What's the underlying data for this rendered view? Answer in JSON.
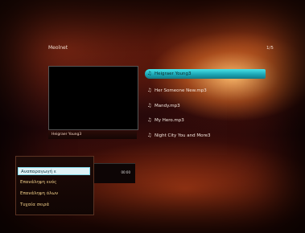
{
  "player": {
    "folder_title": "Meolnet",
    "track_counter": "1/5",
    "now_playing": "Heigraer Young3",
    "time_label": "00:00"
  },
  "tracks": [
    {
      "label": "Heigraer Young3",
      "icon": "music-note-icon"
    },
    {
      "label": "Her Someone New.mp3",
      "icon": "music-note-icon"
    },
    {
      "label": "Mandy.mp3",
      "icon": "music-note-icon"
    },
    {
      "label": "My Hero.mp3",
      "icon": "music-note-icon"
    },
    {
      "label": "Night City You and More3",
      "icon": "music-note-icon"
    }
  ],
  "menu": {
    "items": [
      {
        "label": "Αναπαραγωγή ε",
        "active": true
      },
      {
        "label": "Επανάληψη ενός",
        "active": false
      },
      {
        "label": "Επανάληψη όλων",
        "active": false
      },
      {
        "label": "Τυχαία σειρά",
        "active": false
      }
    ]
  },
  "colors": {
    "accent": "#2ec4cf",
    "menu_text": "#f3d18a",
    "background": "#2a0a06"
  }
}
